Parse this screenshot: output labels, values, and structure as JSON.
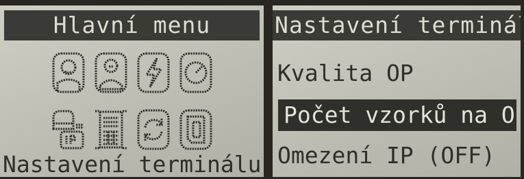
{
  "main_menu": {
    "title": "Hlavní menu",
    "icons": [
      "user-face-icon",
      "user-outline-icon",
      "lightning-icon",
      "clock-icon",
      "ip-network-icon",
      "keypad-device-icon",
      "sync-icon",
      "document-icon"
    ],
    "selected_caption": "Nastavení terminálu"
  },
  "terminal_settings": {
    "title": "Nastavení terminálu",
    "items": [
      {
        "label": "Kvalita OP",
        "selected": false
      },
      {
        "label": "Počet vzorků na OP",
        "selected": true
      },
      {
        "label": "Omezení IP (OFF)",
        "selected": false
      }
    ]
  },
  "colors": {
    "lcd_background": "#c4c4ba",
    "lcd_text": "#2f2f2a",
    "title_bar": "#3a3a36",
    "selection_bar": "#2f2f2b"
  }
}
